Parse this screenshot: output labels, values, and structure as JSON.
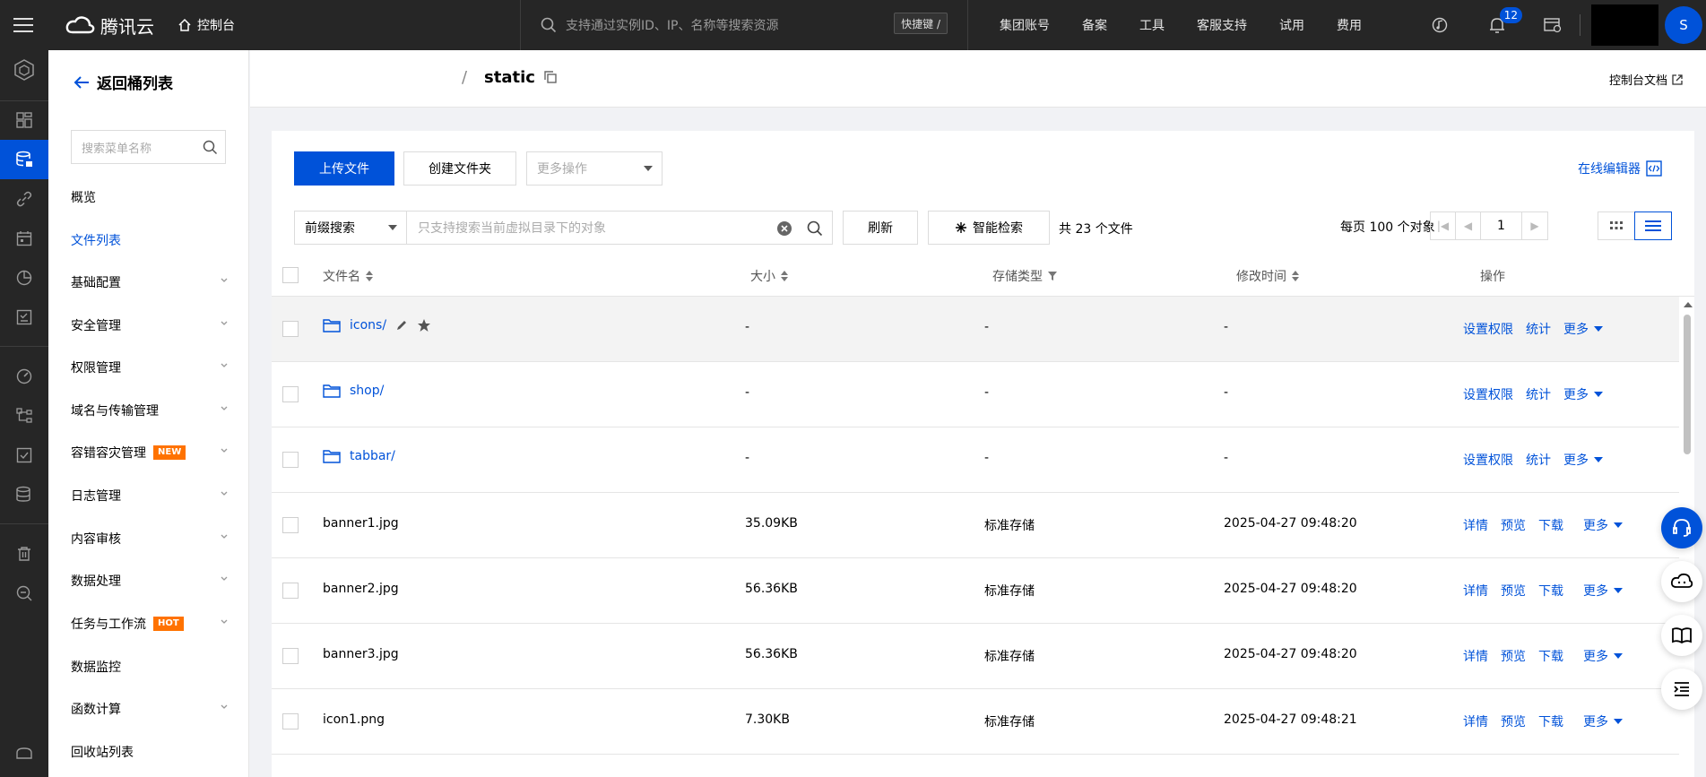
{
  "topbar": {
    "brand": "腾讯云",
    "console": "控制台",
    "search_placeholder": "支持通过实例ID、IP、名称等搜索资源",
    "shortcut": "快捷键 /",
    "nav": [
      "集团账号",
      "备案",
      "工具",
      "客服支持",
      "试用",
      "费用"
    ],
    "notification_count": "12",
    "avatar_letter": "S"
  },
  "sidebar": {
    "back_label": "返回桶列表",
    "search_placeholder": "搜索菜单名称",
    "items": [
      {
        "label": "概览",
        "tag": ""
      },
      {
        "label": "文件列表",
        "tag": ""
      },
      {
        "label": "基础配置",
        "tag": ""
      },
      {
        "label": "安全管理",
        "tag": ""
      },
      {
        "label": "权限管理",
        "tag": ""
      },
      {
        "label": "域名与传输管理",
        "tag": ""
      },
      {
        "label": "容错容灾管理",
        "tag": "NEW"
      },
      {
        "label": "日志管理",
        "tag": ""
      },
      {
        "label": "内容审核",
        "tag": ""
      },
      {
        "label": "数据处理",
        "tag": ""
      },
      {
        "label": "任务与工作流",
        "tag": "HOT"
      },
      {
        "label": "数据监控",
        "tag": ""
      },
      {
        "label": "函数计算",
        "tag": ""
      },
      {
        "label": "回收站列表",
        "tag": ""
      }
    ]
  },
  "header": {
    "separator": "/",
    "title": "static",
    "doc_link": "控制台文档"
  },
  "toolbar": {
    "upload": "上传文件",
    "create_folder": "创建文件夹",
    "more_ops": "更多操作",
    "online_editor": "在线编辑器",
    "search_mode": "前缀搜索",
    "search_placeholder": "只支持搜索当前虚拟目录下的对象",
    "refresh": "刷新",
    "smart_search": "智能检索",
    "total": "共 23 个文件",
    "per_page": "每页 100 个对象",
    "page": "1"
  },
  "table": {
    "headers": {
      "name": "文件名",
      "size": "大小",
      "storage": "存储类型",
      "modified": "修改时间",
      "ops": "操作"
    },
    "rows": [
      {
        "name": "icons/",
        "type": "folder",
        "size": "-",
        "storage": "-",
        "modified": "-",
        "ops": [
          "设置权限",
          "统计",
          "更多"
        ]
      },
      {
        "name": "shop/",
        "type": "folder",
        "size": "-",
        "storage": "-",
        "modified": "-",
        "ops": [
          "设置权限",
          "统计",
          "更多"
        ]
      },
      {
        "name": "tabbar/",
        "type": "folder",
        "size": "-",
        "storage": "-",
        "modified": "-",
        "ops": [
          "设置权限",
          "统计",
          "更多"
        ]
      },
      {
        "name": "banner1.jpg",
        "type": "file",
        "size": "35.09KB",
        "storage": "标准存储",
        "modified": "2025-04-27 09:48:20",
        "ops": [
          "详情",
          "预览",
          "下载",
          "更多"
        ]
      },
      {
        "name": "banner2.jpg",
        "type": "file",
        "size": "56.36KB",
        "storage": "标准存储",
        "modified": "2025-04-27 09:48:20",
        "ops": [
          "详情",
          "预览",
          "下载",
          "更多"
        ]
      },
      {
        "name": "banner3.jpg",
        "type": "file",
        "size": "56.36KB",
        "storage": "标准存储",
        "modified": "2025-04-27 09:48:20",
        "ops": [
          "详情",
          "预览",
          "下载",
          "更多"
        ]
      },
      {
        "name": "icon1.png",
        "type": "file",
        "size": "7.30KB",
        "storage": "标准存储",
        "modified": "2025-04-27 09:48:21",
        "ops": [
          "详情",
          "预览",
          "下载",
          "更多"
        ]
      }
    ]
  },
  "colors": {
    "accent": "#0052d9",
    "topbar": "#262626",
    "tag": "#ff7200"
  }
}
